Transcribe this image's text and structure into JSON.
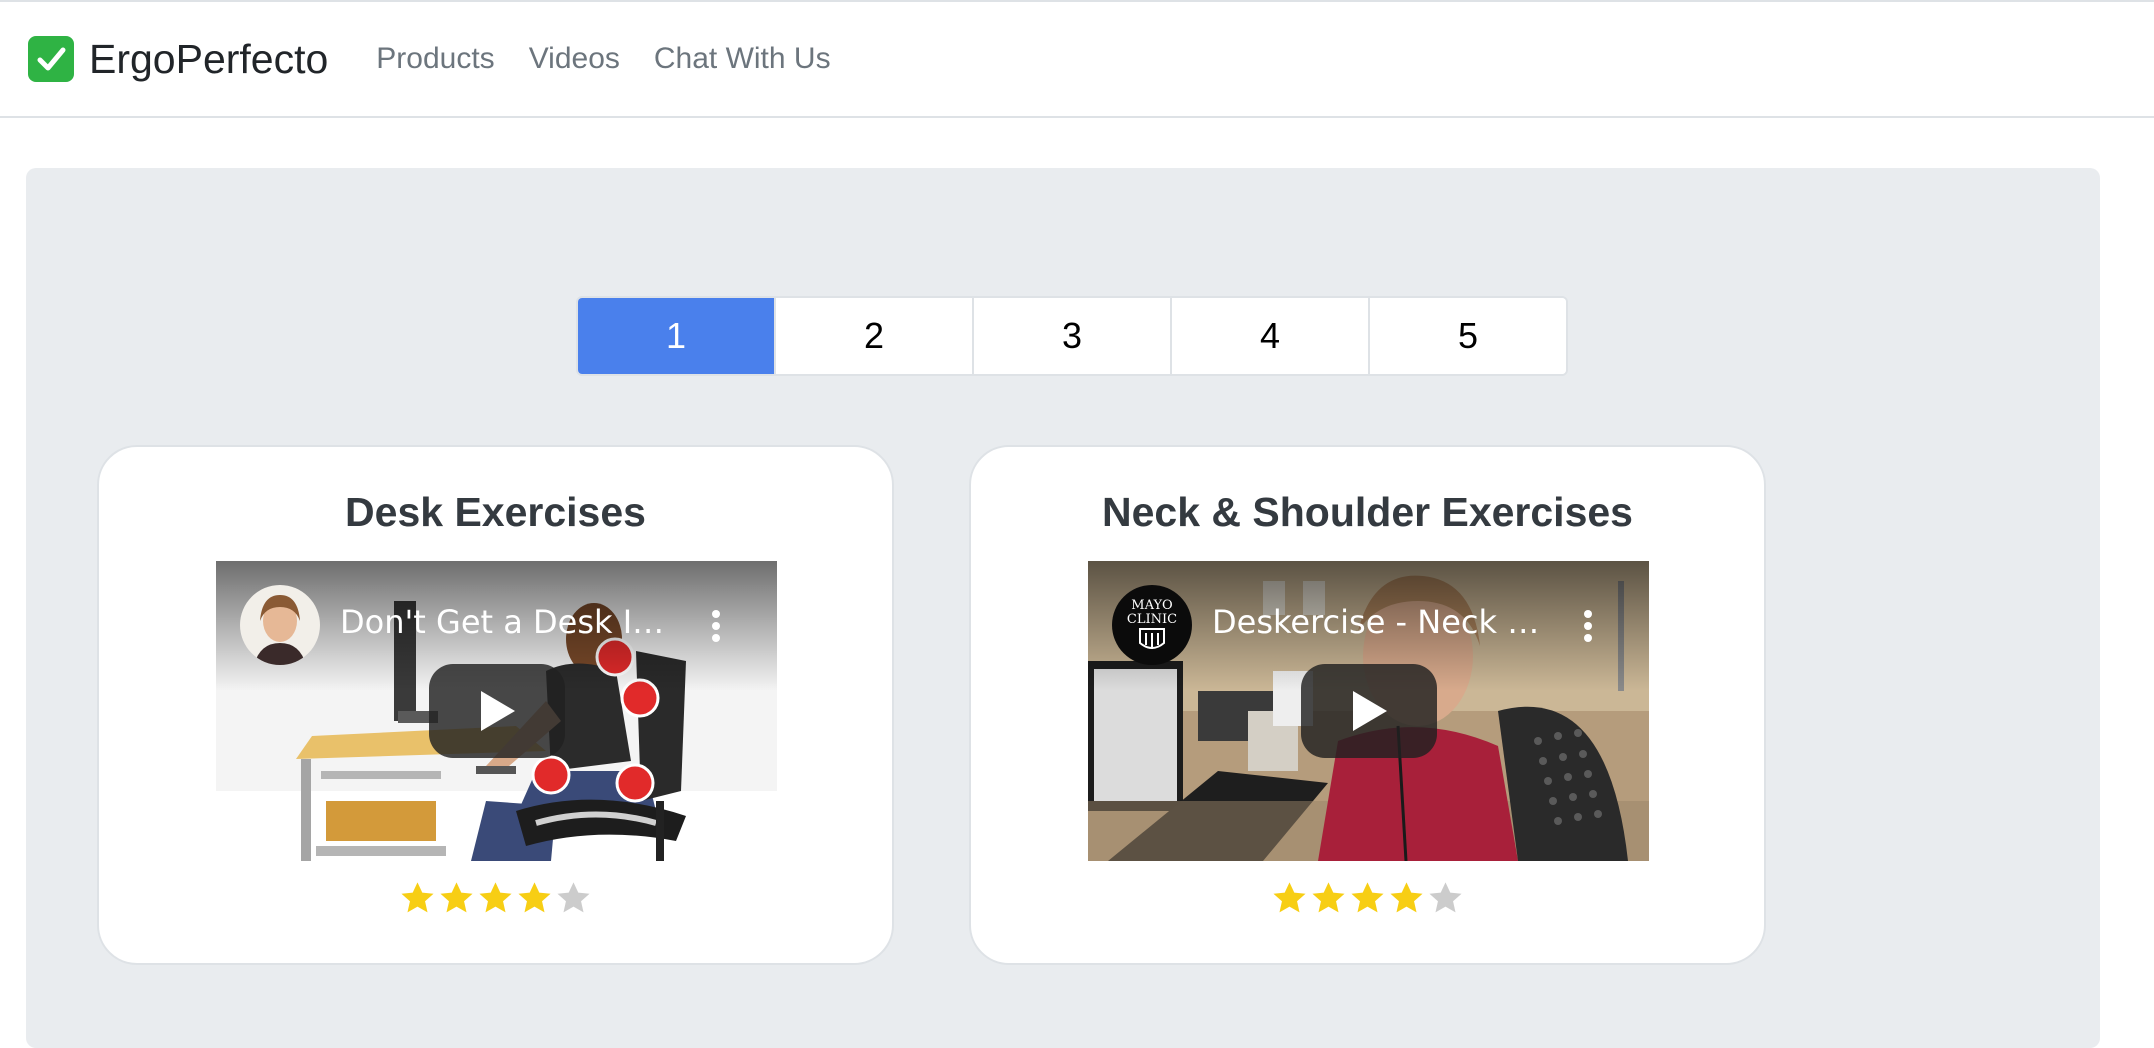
{
  "navbar": {
    "brand": "ErgoPerfecto",
    "links": [
      "Products",
      "Videos",
      "Chat With Us"
    ]
  },
  "pagination": {
    "pages": [
      "1",
      "2",
      "3",
      "4",
      "5"
    ],
    "active": "1"
  },
  "cards": [
    {
      "title": "Desk Exercises",
      "video_title": "Don't Get a Desk Inj...",
      "rating": 4,
      "rating_max": 5
    },
    {
      "title": "Neck & Shoulder Exercises",
      "video_title": "Deskercise - Neck a...",
      "channel_logo_text": [
        "MAYO",
        "CLINIC"
      ],
      "rating": 4,
      "rating_max": 5
    }
  ],
  "colors": {
    "accent": "#4a80ec",
    "star_filled": "#f7ce14",
    "star_empty": "#cccccc",
    "jumbotron_bg": "#e9ecef"
  },
  "icons": {
    "brand": "check-mark-button-icon",
    "play": "play-icon",
    "more": "more-vertical-icon",
    "rating": "star-icon"
  }
}
